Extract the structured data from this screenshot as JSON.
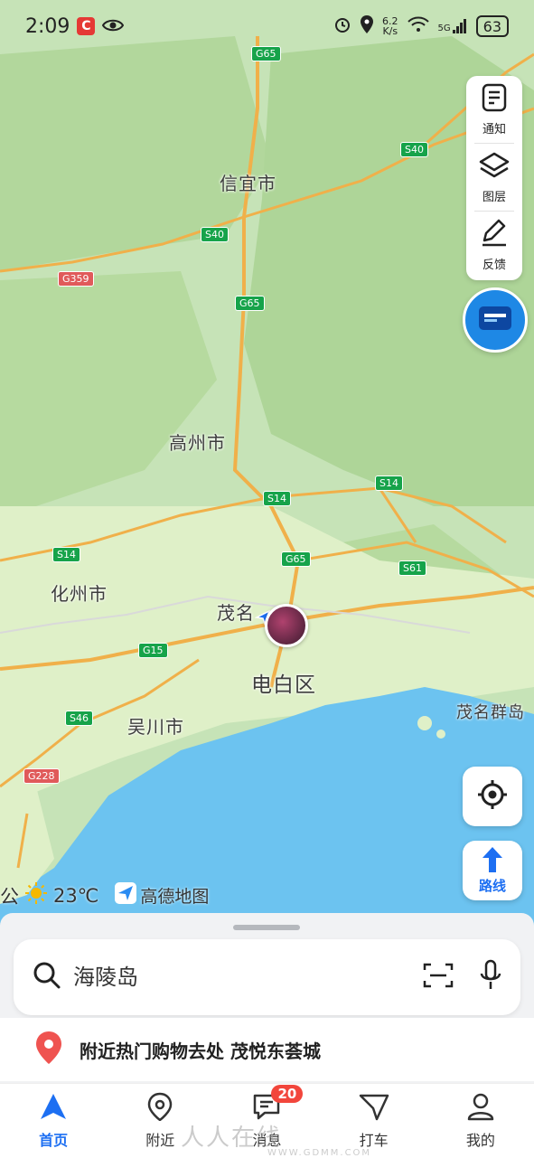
{
  "status_bar": {
    "time": "2:09",
    "app_badge": "C",
    "net_speed": "6.2",
    "net_unit": "K/s",
    "signal": "5G",
    "battery": "63"
  },
  "map_labels": {
    "xinyi": "信宜市",
    "gaozhou": "高州市",
    "huazhou": "化州市",
    "maoming": "茂名",
    "dianbai": "电白区",
    "wuchuan": "吴川市",
    "maoming_islands": "茂名群岛"
  },
  "road_badges": {
    "g65_top": "G65",
    "s40_right": "S40",
    "s40_mid": "S40",
    "g359": "G359",
    "g65_mid": "G65",
    "s14_mid": "S14",
    "s14_right": "S14",
    "s14_left": "S14",
    "g65_low": "G65",
    "s61": "S61",
    "g15": "G15",
    "s46": "S46",
    "g228": "G228"
  },
  "right_panel": {
    "notify_label": "通知",
    "layers_label": "图层",
    "feedback_label": "反馈"
  },
  "route_label": "路线",
  "weather": {
    "prefix": "公",
    "temp": "23℃",
    "logo_text": "高德地图"
  },
  "search": {
    "placeholder": "海陵岛"
  },
  "promo": {
    "text": "附近热门购物去处 茂悦东荟城"
  },
  "tabs": [
    {
      "label": "首页"
    },
    {
      "label": "附近"
    },
    {
      "label": "消息"
    },
    {
      "label": "打车"
    },
    {
      "label": "我的"
    }
  ],
  "message_count": "20",
  "watermark": {
    "main": "人人在线",
    "url": "WWW.GDMM.COM"
  },
  "colors": {
    "accent": "#1d6ff2",
    "sea": "#6cc3f0",
    "land": "#cfe8c9",
    "highway": "#f0b04a",
    "badge_red": "#f2463c"
  }
}
